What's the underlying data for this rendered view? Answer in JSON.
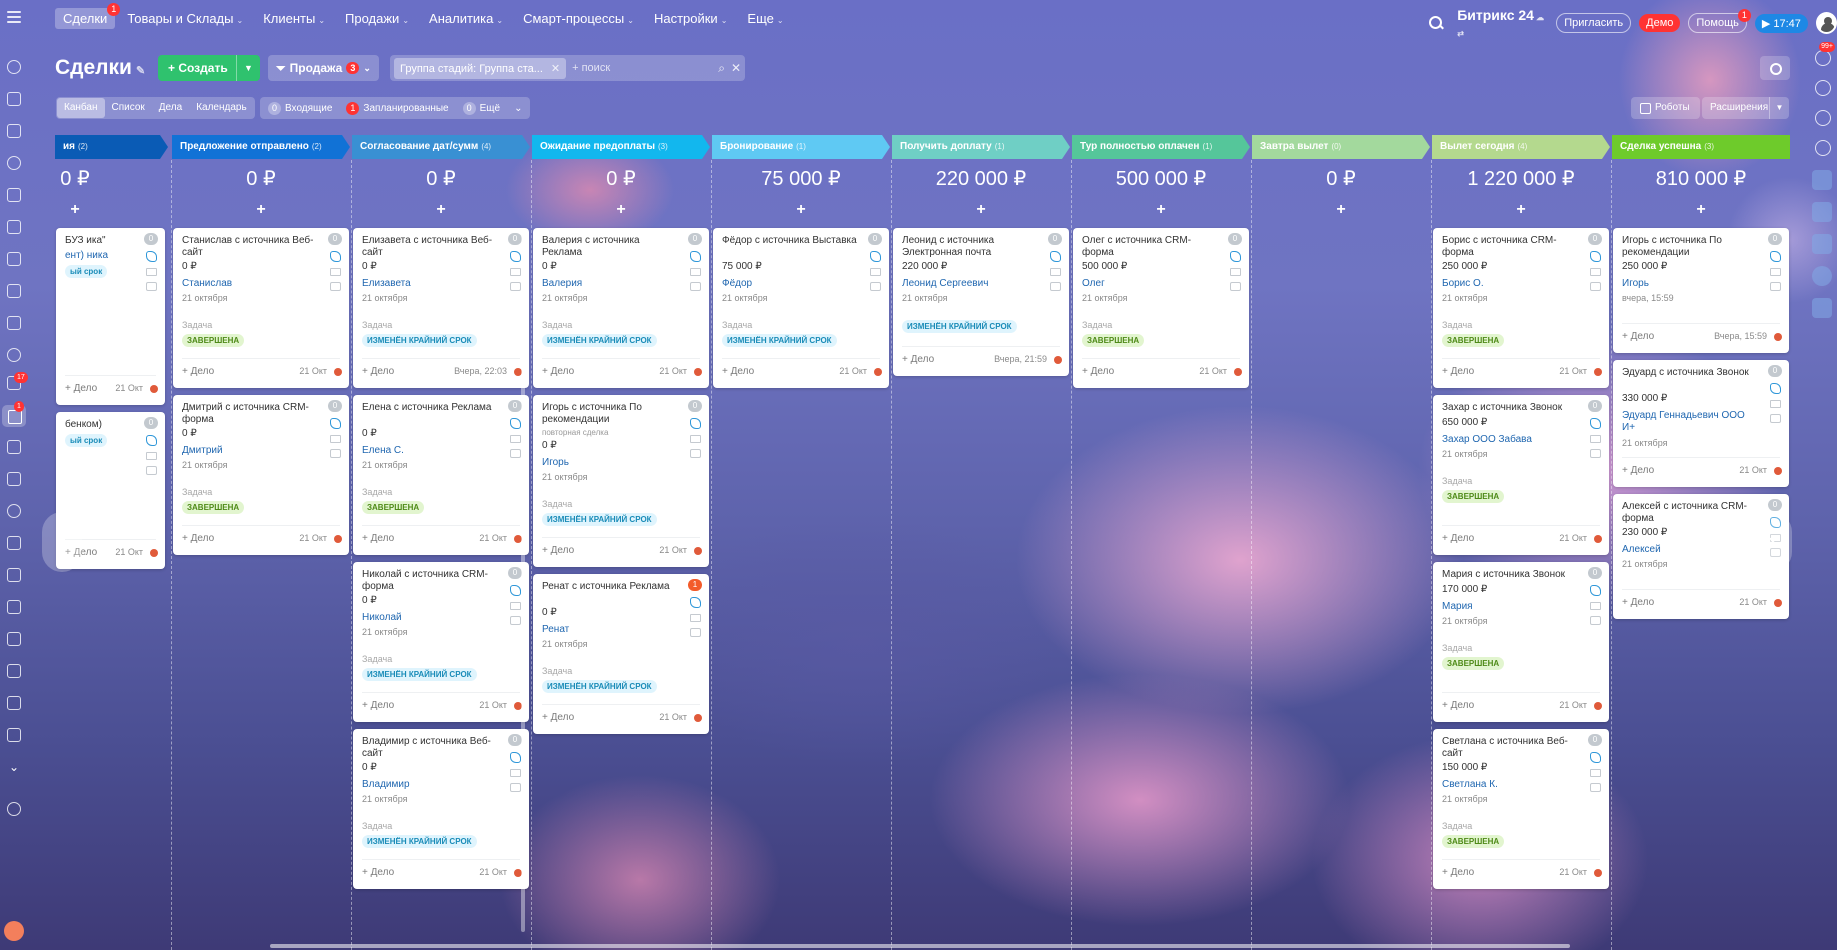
{
  "topbar": {
    "menu": [
      {
        "label": "Сделки",
        "active": true,
        "badge": "1"
      },
      {
        "label": "Товары и Склады",
        "caret": true
      },
      {
        "label": "Клиенты",
        "caret": true
      },
      {
        "label": "Продажи",
        "caret": true
      },
      {
        "label": "Аналитика",
        "caret": true
      },
      {
        "label": "Смарт-процессы",
        "caret": true
      },
      {
        "label": "Настройки",
        "caret": true
      },
      {
        "label": "Еще",
        "caret": true
      }
    ],
    "brand": "Битрикс 24",
    "invite": "Пригласить",
    "demo": "Демо",
    "help": "Помощь",
    "help_badge": "1",
    "time": "17:47"
  },
  "leftbar": {
    "badge_tasks": "17",
    "badge_crm": "1"
  },
  "rightbar": {
    "badge": "99+"
  },
  "toolbar": {
    "title": "Сделки",
    "create_label": "Создать",
    "pipeline_label": "Продажа",
    "pipeline_count": "3",
    "filter_chip": "Группа стадий: Группа ста...",
    "search_placeholder": "+ поиск",
    "view_tabs": [
      "Канбан",
      "Список",
      "Дела",
      "Календарь"
    ],
    "counters": [
      {
        "count": "0",
        "label": "Входящие",
        "red": false
      },
      {
        "count": "1",
        "label": "Запланированные",
        "red": true
      },
      {
        "count": "0",
        "label": "Ещё",
        "red": false
      }
    ],
    "robots_label": "Роботы",
    "extensions_label": "Расширения"
  },
  "columns": [
    {
      "name": "ия",
      "count": "(2)",
      "color": "#0a5bb5",
      "sum": "0 ₽"
    },
    {
      "name": "Предложение отправлено",
      "count": "(2)",
      "color": "#1172d6",
      "sum": "0 ₽"
    },
    {
      "name": "Согласование дат/сумм",
      "count": "(4)",
      "color": "#3990d3",
      "sum": "0 ₽"
    },
    {
      "name": "Ожидание предоплаты",
      "count": "(3)",
      "color": "#12b7ee",
      "sum": "0 ₽"
    },
    {
      "name": "Бронирование",
      "count": "(1)",
      "color": "#5fc9f3",
      "sum": "75 000 ₽"
    },
    {
      "name": "Получить доплату",
      "count": "(1)",
      "color": "#6fcfc5",
      "sum": "220 000 ₽"
    },
    {
      "name": "Тур полностью оплачен",
      "count": "(1)",
      "color": "#55c69a",
      "sum": "500 000 ₽"
    },
    {
      "name": "Завтра вылет",
      "count": "(0)",
      "color": "#a3d99d",
      "sum": "0 ₽"
    },
    {
      "name": "Вылет сегодня",
      "count": "(4)",
      "color": "#b4d98e",
      "sum": "1 220 000 ₽"
    },
    {
      "name": "Сделка успешна",
      "count": "(3)",
      "color": "#6ecb2b",
      "sum": "810 000 ₽"
    }
  ],
  "cards": [
    [
      {
        "title": "БУЗ ика\"",
        "amount": "",
        "client": "ент) ника",
        "date": "",
        "task": "",
        "tag": "ый срок",
        "tag_type": "blue",
        "foot": "21 Окт",
        "count": "0"
      },
      {
        "title": "бенком)",
        "amount": "",
        "client": "",
        "date": "",
        "task": "",
        "tag": "ый срок",
        "tag_type": "blue",
        "foot": "21 Окт",
        "count": "0"
      }
    ],
    [
      {
        "title": "Станислав с источника Веб-сайт",
        "amount": "0 ₽",
        "client": "Станислав",
        "date": "21 октября",
        "task": "Задача",
        "tag": "ЗАВЕРШЕНА",
        "tag_type": "green",
        "foot": "21 Окт",
        "count": "0"
      },
      {
        "title": "Дмитрий с источника CRM-форма",
        "amount": "0 ₽",
        "client": "Дмитрий",
        "date": "21 октября",
        "task": "Задача",
        "tag": "ЗАВЕРШЕНА",
        "tag_type": "green",
        "foot": "21 Окт",
        "count": "0"
      }
    ],
    [
      {
        "title": "Елизавета с источника Веб-сайт",
        "amount": "0 ₽",
        "client": "Елизавета",
        "date": "21 октября",
        "task": "Задача",
        "tag": "ИЗМЕНЁН КРАЙНИЙ СРОК",
        "tag_type": "blue",
        "foot": "Вчера, 22:03",
        "count": "0"
      },
      {
        "title": "Елена с источника Реклама",
        "amount": "0 ₽",
        "client": "Елена С.",
        "date": "21 октября",
        "task": "Задача",
        "tag": "ЗАВЕРШЕНА",
        "tag_type": "green",
        "foot": "21 Окт",
        "count": "0"
      },
      {
        "title": "Николай с источника CRM-форма",
        "amount": "0 ₽",
        "client": "Николай",
        "date": "21 октября",
        "task": "Задача",
        "tag": "ИЗМЕНЁН КРАЙНИЙ СРОК",
        "tag_type": "blue",
        "foot": "21 Окт",
        "count": "0"
      },
      {
        "title": "Владимир с источника Веб-сайт",
        "amount": "0 ₽",
        "client": "Владимир",
        "date": "21 октября",
        "task": "Задача",
        "tag": "ИЗМЕНЁН КРАЙНИЙ СРОК",
        "tag_type": "blue",
        "foot": "21 Окт",
        "count": "0"
      }
    ],
    [
      {
        "title": "Валерия с источника Реклама",
        "amount": "0 ₽",
        "client": "Валерия",
        "date": "21 октября",
        "task": "Задача",
        "tag": "ИЗМЕНЁН КРАЙНИЙ СРОК",
        "tag_type": "blue",
        "foot": "21 Окт",
        "count": "0"
      },
      {
        "title": "Игорь с источника По рекомендации",
        "sub": "повторная сделка",
        "amount": "0 ₽",
        "client": "Игорь",
        "date": "21 октября",
        "task": "Задача",
        "tag": "ИЗМЕНЁН КРАЙНИЙ СРОК",
        "tag_type": "blue",
        "foot": "21 Окт",
        "count": "0"
      },
      {
        "title": "Ренат с источника Реклама",
        "amount": "0 ₽",
        "client": "Ренат",
        "date": "21 октября",
        "task": "Задача",
        "tag": "ИЗМЕНЁН КРАЙНИЙ СРОК",
        "tag_type": "blue",
        "foot": "21 Окт",
        "count": "1",
        "count_red": true
      }
    ],
    [
      {
        "title": "Фёдор с источника Выставка",
        "amount": "75 000 ₽",
        "client": "Фёдор",
        "date": "21 октября",
        "task": "Задача",
        "tag": "ИЗМЕНЁН КРАЙНИЙ СРОК",
        "tag_type": "blue",
        "foot": "21 Окт",
        "count": "0"
      }
    ],
    [
      {
        "title": "Леонид с источника Электронная почта",
        "amount": "220 000 ₽",
        "client": "Леонид Сергеевич",
        "date": "21 октября",
        "task": "",
        "tag": "ИЗМЕНЁН КРАЙНИЙ СРОК",
        "tag_type": "blue",
        "foot": "Вчера, 21:59",
        "count": "0"
      }
    ],
    [
      {
        "title": "Олег с источника CRM-форма",
        "amount": "500 000 ₽",
        "client": "Олег",
        "date": "21 октября",
        "task": "Задача",
        "tag": "ЗАВЕРШЕНА",
        "tag_type": "green",
        "foot": "21 Окт",
        "count": "0"
      }
    ],
    [],
    [
      {
        "title": "Борис с источника CRM-форма",
        "amount": "250 000 ₽",
        "client": "Борис О.",
        "date": "21 октября",
        "task": "Задача",
        "tag": "ЗАВЕРШЕНА",
        "tag_type": "green",
        "foot": "21 Окт",
        "count": "0"
      },
      {
        "title": "Захар с источника Звонок",
        "amount": "650 000 ₽",
        "client": "Захар ООО Забава",
        "date": "21 октября",
        "task": "Задача",
        "tag": "ЗАВЕРШЕНА",
        "tag_type": "green",
        "foot": "21 Окт",
        "count": "0"
      },
      {
        "title": "Мария с источника Звонок",
        "amount": "170 000 ₽",
        "client": "Мария",
        "date": "21 октября",
        "task": "Задача",
        "tag": "ЗАВЕРШЕНА",
        "tag_type": "green",
        "foot": "21 Окт",
        "count": "0"
      },
      {
        "title": "Светлана с источника Веб-сайт",
        "amount": "150 000 ₽",
        "client": "Светлана К.",
        "date": "21 октября",
        "task": "Задача",
        "tag": "ЗАВЕРШЕНА",
        "tag_type": "green",
        "foot": "21 Окт",
        "count": "0"
      }
    ],
    [
      {
        "title": "Игорь с источника По рекомендации",
        "amount": "250 000 ₽",
        "client": "Игорь",
        "date": "вчера, 15:59",
        "task": "",
        "tag": "",
        "foot": "Вчера, 15:59",
        "count": "0"
      },
      {
        "title": "Эдуард с источника Звонок",
        "amount": "330 000 ₽",
        "client": "Эдуард Геннадьевич ООО И+",
        "date": "21 октября",
        "task": "",
        "tag": "",
        "foot": "21 Окт",
        "count": "0"
      },
      {
        "title": "Алексей с источника CRM-форма",
        "amount": "230 000 ₽",
        "client": "Алексей",
        "date": "21 октября",
        "task": "",
        "tag": "",
        "foot": "21 Окт",
        "count": "0"
      }
    ]
  ],
  "add_deal_label": "+ Дело",
  "plus": "+"
}
